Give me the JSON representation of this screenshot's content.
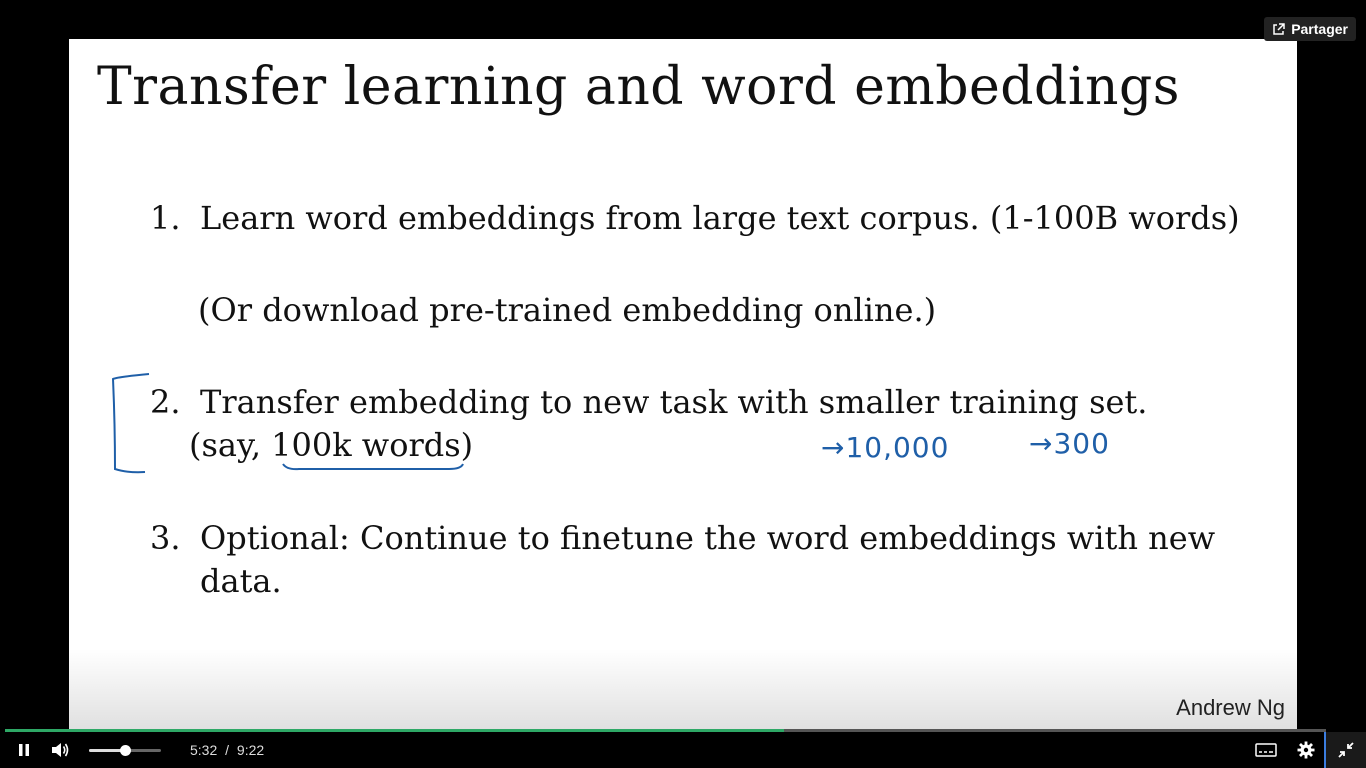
{
  "slide": {
    "title": "Transfer learning and word embeddings",
    "items": [
      {
        "number": "1.",
        "text": "Learn word embeddings from large text corpus. (1-100B words)"
      },
      {
        "sub": "(Or download pre-trained embedding online.)"
      },
      {
        "number": "2.",
        "text": "Transfer embedding to new task with smaller training set.",
        "sub_prefix": "(say, ",
        "sub_underlined": "100k words",
        "sub_suffix": ")"
      },
      {
        "number": "3.",
        "text": "Optional: Continue to finetune the word embeddings with new",
        "continuation": "data."
      }
    ],
    "annotations": [
      "→10,000",
      "→300"
    ],
    "author": "Andrew Ng"
  },
  "share": {
    "label": "Partager",
    "icon": "share-icon"
  },
  "player": {
    "current_time": "5:32",
    "separator": "/",
    "duration": "9:22",
    "progress_fraction": 0.59,
    "volume_fraction": 0.5,
    "accent_color": "#2ea866"
  }
}
